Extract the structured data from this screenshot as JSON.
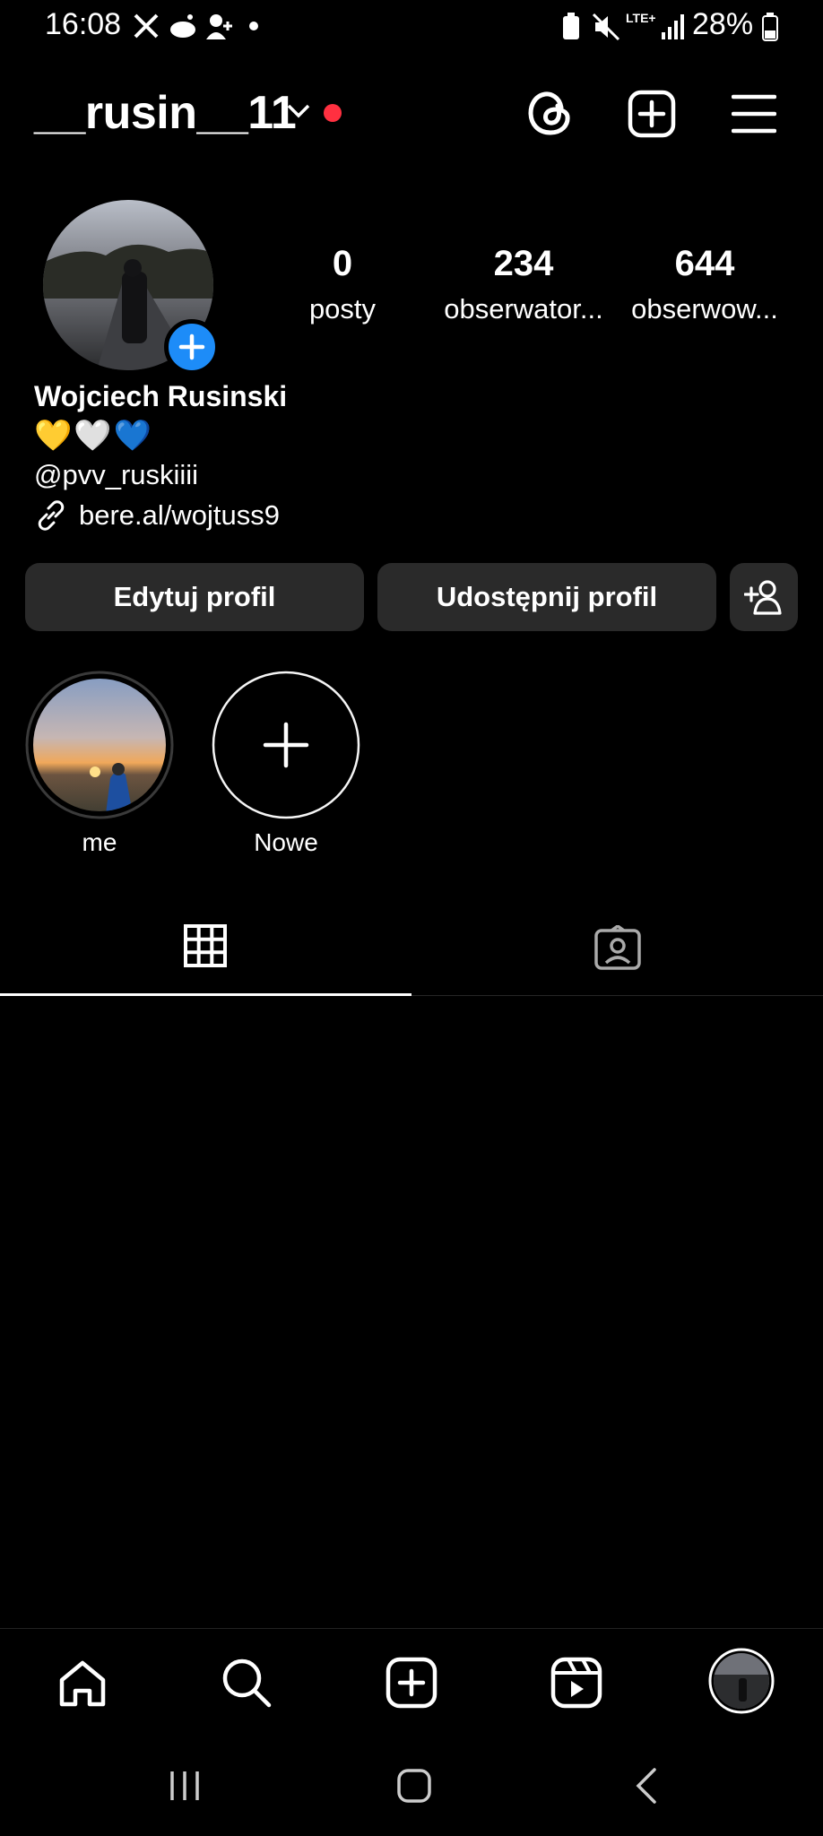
{
  "status_bar": {
    "time": "16:08",
    "battery": "28%",
    "network": "LTE+"
  },
  "header": {
    "username": "__rusin__11"
  },
  "profile": {
    "stats": [
      {
        "value": "0",
        "label": "posty"
      },
      {
        "value": "234",
        "label": "obserwator..."
      },
      {
        "value": "644",
        "label": "obserwow..."
      }
    ],
    "full_name": "Wojciech Rusinski",
    "bio_emojis": "💛🤍💙",
    "handle": "@pvv_ruskiiii",
    "link": "bere.al/wojtuss9"
  },
  "actions": {
    "edit_label": "Edytuj profil",
    "share_label": "Udostępnij profil"
  },
  "highlights": [
    {
      "label": "me"
    },
    {
      "label": "Nowe"
    }
  ],
  "colors": {
    "background": "#000000",
    "button_bg": "#2a2a2a",
    "accent_blue": "#1d8cf8",
    "notification_red": "#ff3040"
  },
  "icons": {
    "header": [
      "threads-icon",
      "create-icon",
      "menu-icon"
    ],
    "tabs": [
      "grid-icon",
      "tagged-icon"
    ],
    "nav": [
      "home-icon",
      "search-icon",
      "create-icon",
      "reels-icon",
      "profile-avatar"
    ]
  }
}
